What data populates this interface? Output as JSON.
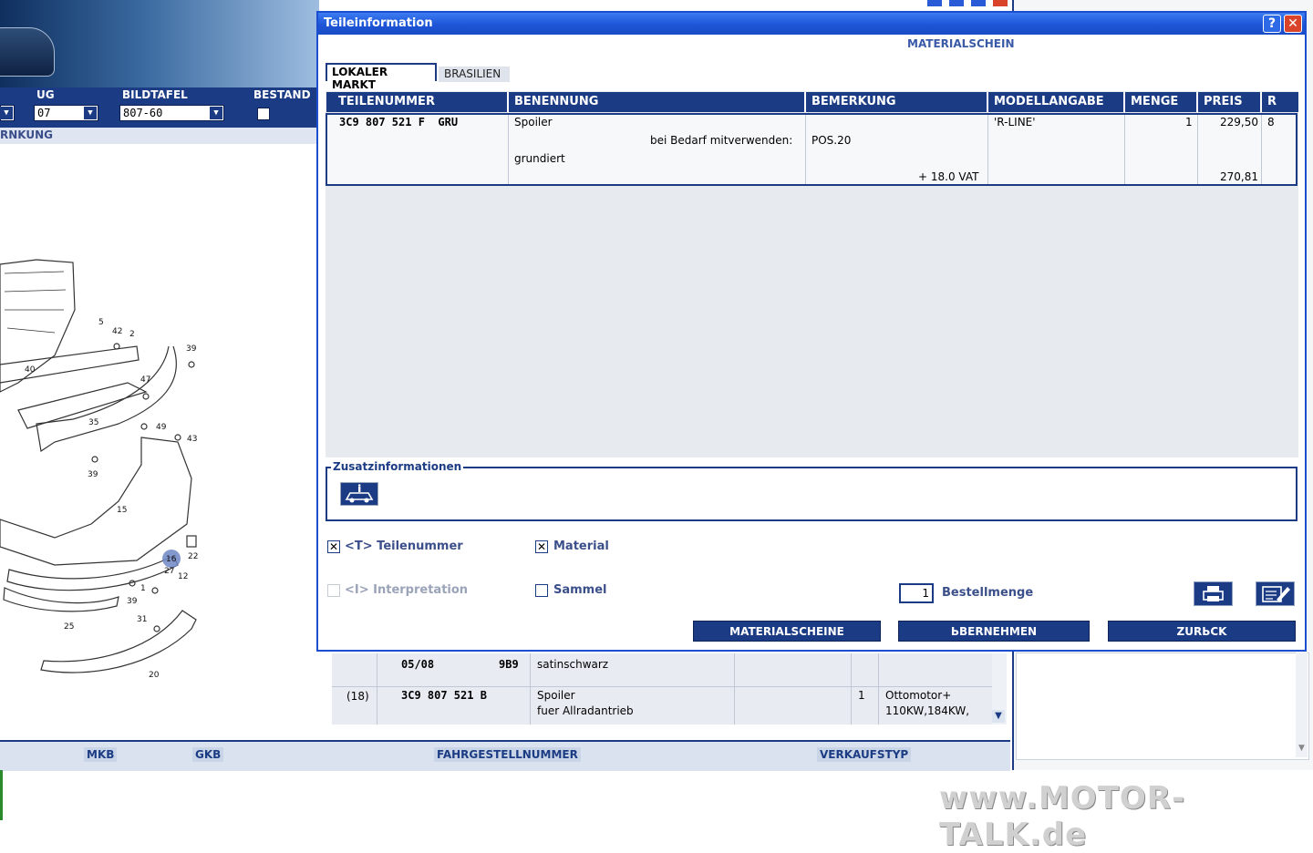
{
  "background_app": {
    "filters": {
      "ug_label": "UG",
      "ug_value": "07",
      "bildtafel_label": "BILDTAFEL",
      "bildtafel_value": "807-60",
      "bestand_label": "BESTAND"
    },
    "strip_text": "RNKUNG",
    "diagram_numbers": [
      "5",
      "42",
      "2",
      "39",
      "40",
      "47",
      "35",
      "49",
      "43",
      "39",
      "15",
      "16",
      "22",
      "27",
      "12",
      "1",
      "39",
      "25",
      "31",
      "20"
    ],
    "table_rows": [
      {
        "pos": "",
        "part": "05/08",
        "code": "9B9",
        "text": "satinschwarz",
        "qty": "",
        "info": ""
      },
      {
        "pos": "(18)",
        "part": "3C9 807 521 B",
        "code": "",
        "text": "Spoiler",
        "text2": "fuer Allradantrieb",
        "qty": "1",
        "info": "Ottomotor+",
        "info2": "110KW,184KW,"
      }
    ],
    "bottom_buttons": [
      "MKB",
      "GKB",
      "FAHRGESTELLNUMMER",
      "VERKAUFSTYP"
    ],
    "watermark": "www.MOTOR-TALK.de"
  },
  "dialog": {
    "title": "Teileinformation",
    "help_symbol": "?",
    "close_symbol": "✕",
    "subtitle": "MATERIALSCHEIN",
    "tabs": [
      "LOKALER MARKT",
      "BRASILIEN"
    ],
    "columns": [
      "TEILENUMMER",
      "BENENNUNG",
      "BEMERKUNG",
      "MODELLANGABE",
      "MENGE",
      "PREIS",
      "R"
    ],
    "row": {
      "teilenummer": "3C9 807 521 F  GRU",
      "benennung": "Spoiler",
      "hint_label": "bei Bedarf mitverwenden:",
      "hint_value": "POS.20",
      "benennung2": "grundiert",
      "vat": "+ 18.0 VAT",
      "modellangabe": "'R-LINE'",
      "menge": "1",
      "preis": "229,50",
      "preis_vat": "270,81",
      "r": "8"
    },
    "zusatz_label": "Zusatzinformationen",
    "zusatz_icon": "vehicle-info-icon",
    "options": {
      "teilenummer": {
        "label": "<T> Teilenummer",
        "checked": true,
        "mark": "✕"
      },
      "material": {
        "label": "Material",
        "checked": true,
        "mark": "✕"
      },
      "interpretation": {
        "label": "<I> Interpretation",
        "checked": false,
        "disabled": true
      },
      "sammel": {
        "label": "Sammel",
        "checked": false
      }
    },
    "bestellmenge_label": "Bestellmenge",
    "bestellmenge_value": "1",
    "icons": [
      "printer-icon",
      "edit-note-icon"
    ],
    "buttons": [
      "MATERIALSCHEINE",
      "ЬBERNEHMEN",
      "ZURЬCK"
    ],
    "colors": {
      "primary": "#1b3c84",
      "title_bar": "#1d55d8",
      "list_bg": "#e7eaee"
    }
  }
}
